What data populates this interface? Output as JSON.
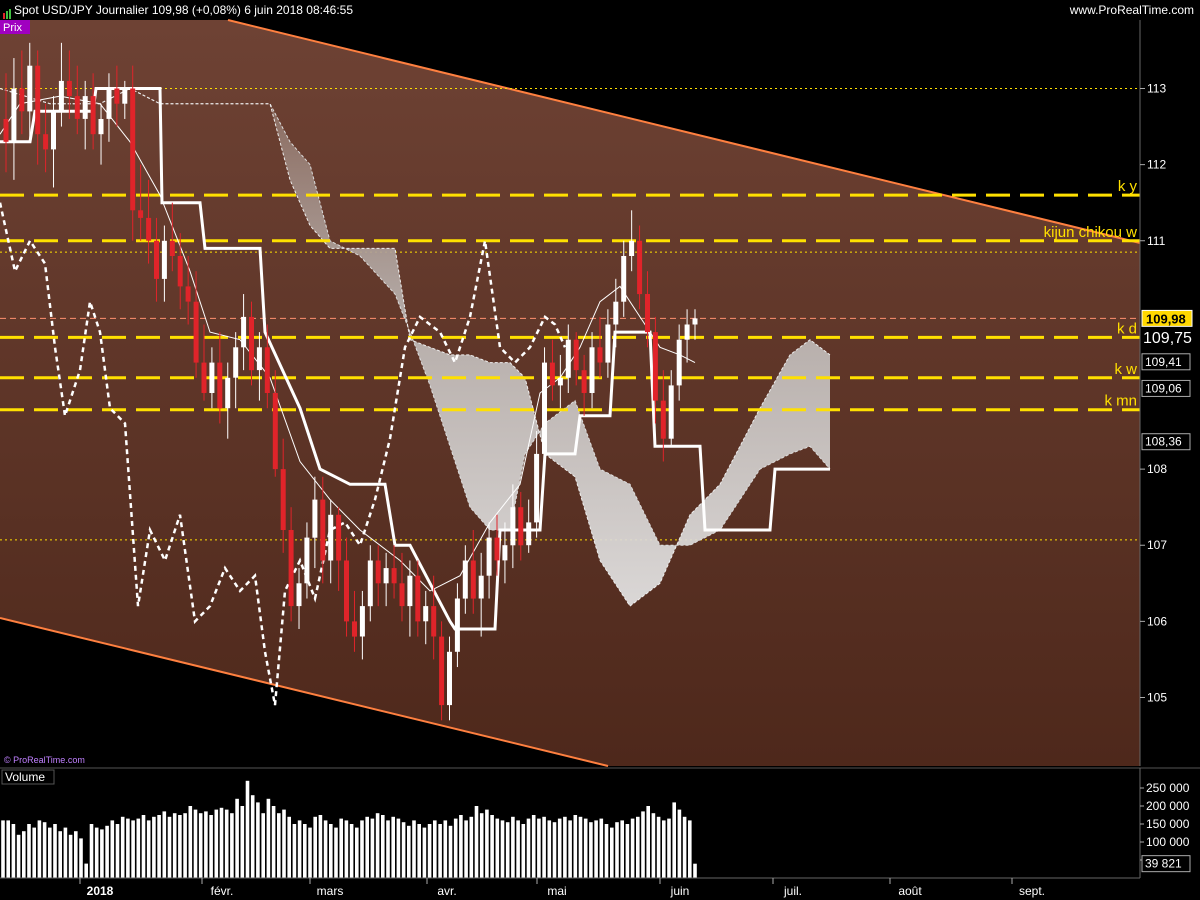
{
  "header": {
    "title": "Spot USD/JPY    Journalier    109,98 (+0,08%)    6 juin 2018 08:46:55",
    "site": "www.ProRealTime.com",
    "price_panel_label": "Prix",
    "volume_panel_label": "Volume",
    "watermark": "© ProRealTime.com"
  },
  "colors": {
    "background_price": "#5a3122",
    "up_candle": "#ffffff",
    "down_candle": "#e0242a",
    "channel": "#ff8040",
    "levels": "#ffe000",
    "cloud": "#bfbfbf"
  },
  "chart_data": [
    {
      "type": "line",
      "title": "",
      "ylim": [
        104.1,
        113.9
      ],
      "x_ticks": [
        "2018",
        "févr.",
        "mars",
        "avr.",
        "mai",
        "juin",
        "juil.",
        "août",
        "sept."
      ],
      "y_ticks": [
        "113",
        "112",
        "111",
        "108",
        "107",
        "106",
        "105"
      ],
      "price_tags": [
        {
          "label": "109,98",
          "value": 109.98,
          "style": "current"
        },
        {
          "label": "109,75",
          "value": 109.75,
          "style": "large"
        },
        {
          "label": "109,41",
          "value": 109.41,
          "style": "box"
        },
        {
          "label": "109,06",
          "value": 109.06,
          "style": "box"
        },
        {
          "label": "108,36",
          "value": 108.36,
          "style": "box"
        }
      ],
      "levels": [
        {
          "label": "k y",
          "value": 111.6
        },
        {
          "label": "kijun chikou w",
          "value": 111.0
        },
        {
          "label": "k d",
          "value": 109.73
        },
        {
          "label": "k w",
          "value": 109.2
        },
        {
          "label": "k mn",
          "value": 108.78
        }
      ],
      "dotted_levels": [
        113.0,
        110.85,
        107.07
      ],
      "series": [
        {
          "name": "Kijun",
          "x": [
            0,
            30,
            35,
            60,
            93,
            96,
            160,
            162,
            200,
            205,
            260,
            265,
            300,
            320,
            350,
            385,
            395,
            410,
            450,
            455,
            495,
            500,
            540,
            545,
            575,
            580,
            610,
            615,
            650,
            655,
            700,
            705,
            770,
            775,
            830
          ],
          "y": [
            112.3,
            112.3,
            112.7,
            112.7,
            112.7,
            113.0,
            113.0,
            111.5,
            111.5,
            110.9,
            110.9,
            109.8,
            108.8,
            108.0,
            107.8,
            107.8,
            107.0,
            107.0,
            106.0,
            105.9,
            105.9,
            107.2,
            107.2,
            108.2,
            108.2,
            108.7,
            108.7,
            109.8,
            109.8,
            108.3,
            108.3,
            107.2,
            107.2,
            108.0,
            108.0
          ]
        },
        {
          "name": "Tenkan",
          "x": [
            0,
            20,
            60,
            100,
            130,
            160,
            190,
            210,
            240,
            270,
            300,
            330,
            360,
            400,
            430,
            460,
            490,
            520,
            540,
            560,
            580,
            600,
            620,
            640,
            660,
            680,
            695
          ],
          "y": [
            112.4,
            112.8,
            112.9,
            112.8,
            112.3,
            111.6,
            110.6,
            109.8,
            109.7,
            109.2,
            108.1,
            107.6,
            107.2,
            106.8,
            106.4,
            106.6,
            107.3,
            107.8,
            109.0,
            109.2,
            109.6,
            110.2,
            110.4,
            110.0,
            109.6,
            109.5,
            109.4
          ]
        },
        {
          "name": "Chikou",
          "x": [
            0,
            15,
            30,
            45,
            55,
            65,
            80,
            90,
            100,
            110,
            125,
            138,
            150,
            165,
            180,
            195,
            210,
            225,
            240,
            255,
            265,
            275,
            285,
            300,
            315,
            330,
            345,
            360,
            375,
            390,
            405,
            420,
            440,
            455,
            470,
            485,
            500,
            515,
            530,
            545,
            555,
            565
          ],
          "y": [
            111.5,
            110.6,
            111.0,
            110.7,
            109.6,
            108.7,
            109.3,
            110.2,
            109.8,
            108.8,
            108.6,
            106.2,
            107.2,
            106.8,
            107.4,
            106.0,
            106.2,
            106.7,
            106.4,
            106.6,
            105.6,
            104.9,
            106.4,
            106.8,
            106.3,
            107.2,
            107.3,
            107.0,
            107.6,
            108.4,
            109.6,
            110.0,
            109.8,
            109.4,
            110.0,
            111.0,
            109.6,
            109.4,
            109.6,
            110.0,
            109.9,
            109.6
          ]
        }
      ],
      "cloud": {
        "x": [
          0,
          50,
          100,
          130,
          160,
          200,
          240,
          270,
          290,
          310,
          330,
          360,
          395,
          410,
          430,
          450,
          470,
          490,
          510,
          525,
          545,
          575,
          600,
          630,
          660,
          690,
          720,
          760,
          790,
          810,
          830
        ],
        "span_a": [
          113.0,
          112.8,
          112.8,
          113.0,
          112.8,
          112.8,
          112.8,
          112.8,
          112.3,
          112.0,
          111.0,
          110.8,
          110.3,
          109.8,
          109.1,
          108.3,
          107.5,
          107.2,
          107.2,
          108.2,
          108.6,
          108.9,
          108.0,
          107.8,
          107.0,
          107.0,
          107.2,
          108.0,
          108.2,
          108.3,
          108.0
        ],
        "span_b": [
          113.0,
          112.8,
          112.8,
          113.0,
          112.8,
          112.8,
          112.8,
          112.8,
          111.8,
          111.2,
          110.9,
          110.9,
          110.9,
          109.7,
          109.6,
          109.5,
          109.5,
          109.4,
          109.4,
          109.2,
          108.2,
          107.9,
          106.8,
          106.2,
          106.5,
          107.4,
          107.8,
          108.8,
          109.5,
          109.7,
          109.5
        ]
      },
      "candles": [
        {
          "o": 112.6,
          "h": 113.2,
          "l": 111.9,
          "c": 112.3
        },
        {
          "o": 112.3,
          "h": 113.4,
          "l": 111.8,
          "c": 113.0
        },
        {
          "o": 113.0,
          "h": 113.5,
          "l": 112.4,
          "c": 112.7
        },
        {
          "o": 112.7,
          "h": 113.6,
          "l": 112.3,
          "c": 113.3
        },
        {
          "o": 113.3,
          "h": 113.5,
          "l": 112.0,
          "c": 112.4
        },
        {
          "o": 112.4,
          "h": 112.8,
          "l": 111.9,
          "c": 112.2
        },
        {
          "o": 112.2,
          "h": 112.9,
          "l": 111.7,
          "c": 112.7
        },
        {
          "o": 112.7,
          "h": 113.6,
          "l": 112.5,
          "c": 113.1
        },
        {
          "o": 113.1,
          "h": 113.5,
          "l": 112.6,
          "c": 112.9
        },
        {
          "o": 112.9,
          "h": 113.3,
          "l": 112.4,
          "c": 112.6
        },
        {
          "o": 112.6,
          "h": 113.1,
          "l": 112.2,
          "c": 112.9
        },
        {
          "o": 112.9,
          "h": 113.2,
          "l": 112.2,
          "c": 112.4
        },
        {
          "o": 112.4,
          "h": 112.8,
          "l": 112.0,
          "c": 112.6
        },
        {
          "o": 112.6,
          "h": 113.2,
          "l": 112.3,
          "c": 113.0
        },
        {
          "o": 113.0,
          "h": 113.3,
          "l": 112.5,
          "c": 112.8
        },
        {
          "o": 112.8,
          "h": 113.1,
          "l": 112.6,
          "c": 113.0
        },
        {
          "o": 113.0,
          "h": 113.3,
          "l": 111.0,
          "c": 111.4
        },
        {
          "o": 111.4,
          "h": 112.0,
          "l": 111.0,
          "c": 111.3
        },
        {
          "o": 111.3,
          "h": 111.8,
          "l": 110.7,
          "c": 111.0
        },
        {
          "o": 111.0,
          "h": 111.3,
          "l": 110.2,
          "c": 110.5
        },
        {
          "o": 110.5,
          "h": 111.2,
          "l": 110.2,
          "c": 111.0
        },
        {
          "o": 111.0,
          "h": 111.5,
          "l": 110.6,
          "c": 110.8
        },
        {
          "o": 110.8,
          "h": 111.1,
          "l": 110.1,
          "c": 110.4
        },
        {
          "o": 110.4,
          "h": 110.8,
          "l": 109.9,
          "c": 110.2
        },
        {
          "o": 110.2,
          "h": 110.6,
          "l": 109.2,
          "c": 109.4
        },
        {
          "o": 109.4,
          "h": 109.9,
          "l": 108.9,
          "c": 109.0
        },
        {
          "o": 109.0,
          "h": 109.6,
          "l": 108.8,
          "c": 109.4
        },
        {
          "o": 109.4,
          "h": 109.8,
          "l": 108.6,
          "c": 108.8
        },
        {
          "o": 108.8,
          "h": 109.4,
          "l": 108.4,
          "c": 109.2
        },
        {
          "o": 109.2,
          "h": 109.8,
          "l": 108.8,
          "c": 109.6
        },
        {
          "o": 109.6,
          "h": 110.3,
          "l": 109.3,
          "c": 110.0
        },
        {
          "o": 110.0,
          "h": 110.2,
          "l": 109.1,
          "c": 109.3
        },
        {
          "o": 109.3,
          "h": 109.8,
          "l": 108.9,
          "c": 109.6
        },
        {
          "o": 109.6,
          "h": 109.9,
          "l": 108.8,
          "c": 109.0
        },
        {
          "o": 109.0,
          "h": 109.3,
          "l": 107.9,
          "c": 108.0
        },
        {
          "o": 108.0,
          "h": 108.4,
          "l": 106.9,
          "c": 107.2
        },
        {
          "o": 107.2,
          "h": 107.5,
          "l": 106.0,
          "c": 106.2
        },
        {
          "o": 106.2,
          "h": 106.7,
          "l": 105.9,
          "c": 106.5
        },
        {
          "o": 106.5,
          "h": 107.3,
          "l": 106.3,
          "c": 107.1
        },
        {
          "o": 107.1,
          "h": 107.9,
          "l": 106.7,
          "c": 107.6
        },
        {
          "o": 107.6,
          "h": 107.9,
          "l": 106.5,
          "c": 106.8
        },
        {
          "o": 106.8,
          "h": 107.6,
          "l": 106.5,
          "c": 107.4
        },
        {
          "o": 107.4,
          "h": 107.5,
          "l": 106.4,
          "c": 106.8
        },
        {
          "o": 106.8,
          "h": 107.1,
          "l": 105.8,
          "c": 106.0
        },
        {
          "o": 106.0,
          "h": 106.4,
          "l": 105.6,
          "c": 105.8
        },
        {
          "o": 105.8,
          "h": 106.4,
          "l": 105.5,
          "c": 106.2
        },
        {
          "o": 106.2,
          "h": 107.0,
          "l": 106.0,
          "c": 106.8
        },
        {
          "o": 106.8,
          "h": 107.0,
          "l": 106.2,
          "c": 106.5
        },
        {
          "o": 106.5,
          "h": 106.9,
          "l": 106.2,
          "c": 106.7
        },
        {
          "o": 106.7,
          "h": 107.0,
          "l": 106.3,
          "c": 106.5
        },
        {
          "o": 106.5,
          "h": 106.9,
          "l": 106.0,
          "c": 106.2
        },
        {
          "o": 106.2,
          "h": 106.8,
          "l": 105.8,
          "c": 106.6
        },
        {
          "o": 106.6,
          "h": 106.8,
          "l": 105.8,
          "c": 106.0
        },
        {
          "o": 106.0,
          "h": 106.4,
          "l": 105.7,
          "c": 106.2
        },
        {
          "o": 106.2,
          "h": 106.6,
          "l": 105.5,
          "c": 105.8
        },
        {
          "o": 105.8,
          "h": 106.0,
          "l": 104.7,
          "c": 104.9
        },
        {
          "o": 104.9,
          "h": 105.8,
          "l": 104.7,
          "c": 105.6
        },
        {
          "o": 105.6,
          "h": 106.5,
          "l": 105.4,
          "c": 106.3
        },
        {
          "o": 106.3,
          "h": 107.0,
          "l": 106.1,
          "c": 106.8
        },
        {
          "o": 106.8,
          "h": 107.2,
          "l": 106.1,
          "c": 106.3
        },
        {
          "o": 106.3,
          "h": 106.9,
          "l": 105.8,
          "c": 106.6
        },
        {
          "o": 106.6,
          "h": 107.3,
          "l": 106.3,
          "c": 107.1
        },
        {
          "o": 107.1,
          "h": 107.4,
          "l": 106.6,
          "c": 106.8
        },
        {
          "o": 106.8,
          "h": 107.3,
          "l": 106.5,
          "c": 107.0
        },
        {
          "o": 107.0,
          "h": 107.8,
          "l": 106.7,
          "c": 107.5
        },
        {
          "o": 107.5,
          "h": 107.7,
          "l": 106.8,
          "c": 107.0
        },
        {
          "o": 107.0,
          "h": 107.6,
          "l": 106.9,
          "c": 107.3
        },
        {
          "o": 107.3,
          "h": 108.5,
          "l": 107.1,
          "c": 108.2
        },
        {
          "o": 108.2,
          "h": 109.6,
          "l": 108.0,
          "c": 109.4
        },
        {
          "o": 109.4,
          "h": 109.7,
          "l": 108.9,
          "c": 109.1
        },
        {
          "o": 109.1,
          "h": 109.5,
          "l": 108.8,
          "c": 109.2
        },
        {
          "o": 109.2,
          "h": 109.9,
          "l": 109.0,
          "c": 109.7
        },
        {
          "o": 109.7,
          "h": 109.8,
          "l": 109.1,
          "c": 109.3
        },
        {
          "o": 109.3,
          "h": 109.5,
          "l": 108.7,
          "c": 109.0
        },
        {
          "o": 109.0,
          "h": 109.8,
          "l": 108.8,
          "c": 109.6
        },
        {
          "o": 109.6,
          "h": 110.0,
          "l": 109.2,
          "c": 109.4
        },
        {
          "o": 109.4,
          "h": 110.1,
          "l": 109.2,
          "c": 109.9
        },
        {
          "o": 109.9,
          "h": 110.5,
          "l": 109.6,
          "c": 110.2
        },
        {
          "o": 110.2,
          "h": 111.0,
          "l": 110.0,
          "c": 110.8
        },
        {
          "o": 110.8,
          "h": 111.4,
          "l": 110.6,
          "c": 111.0
        },
        {
          "o": 111.0,
          "h": 111.2,
          "l": 110.1,
          "c": 110.3
        },
        {
          "o": 110.3,
          "h": 110.6,
          "l": 109.6,
          "c": 109.8
        },
        {
          "o": 109.8,
          "h": 110.0,
          "l": 108.6,
          "c": 108.9
        },
        {
          "o": 108.9,
          "h": 109.3,
          "l": 108.1,
          "c": 108.4
        },
        {
          "o": 108.4,
          "h": 109.3,
          "l": 108.3,
          "c": 109.1
        },
        {
          "o": 109.1,
          "h": 109.9,
          "l": 108.9,
          "c": 109.7
        },
        {
          "o": 109.7,
          "h": 110.1,
          "l": 109.4,
          "c": 109.9
        },
        {
          "o": 109.9,
          "h": 110.1,
          "l": 109.7,
          "c": 109.98
        }
      ]
    },
    {
      "type": "bar",
      "title": "",
      "ylim": [
        0,
        300000
      ],
      "y_ticks": [
        "250 000",
        "200 000",
        "150 000",
        "100 000",
        "50 000"
      ],
      "last_value_label": "39 821",
      "values": [
        160000,
        160000,
        150000,
        120000,
        130000,
        150000,
        140000,
        160000,
        155000,
        140000,
        150000,
        130000,
        140000,
        120000,
        130000,
        110000,
        40000,
        150000,
        140000,
        135000,
        145000,
        160000,
        150000,
        170000,
        165000,
        160000,
        165000,
        175000,
        160000,
        170000,
        175000,
        185000,
        170000,
        180000,
        175000,
        180000,
        200000,
        190000,
        180000,
        185000,
        175000,
        190000,
        195000,
        190000,
        180000,
        220000,
        200000,
        270000,
        230000,
        210000,
        180000,
        220000,
        200000,
        180000,
        190000,
        170000,
        150000,
        160000,
        150000,
        140000,
        170000,
        175000,
        160000,
        150000,
        140000,
        165000,
        160000,
        150000,
        140000,
        160000,
        170000,
        165000,
        180000,
        175000,
        160000,
        170000,
        165000,
        155000,
        145000,
        160000,
        150000,
        140000,
        150000,
        160000,
        150000,
        160000,
        145000,
        165000,
        175000,
        160000,
        170000,
        200000,
        180000,
        190000,
        175000,
        165000,
        160000,
        155000,
        170000,
        160000,
        150000,
        165000,
        175000,
        165000,
        170000,
        160000,
        155000,
        165000,
        170000,
        160000,
        175000,
        170000,
        165000,
        155000,
        160000,
        165000,
        150000,
        140000,
        155000,
        160000,
        150000,
        165000,
        170000,
        185000,
        200000,
        180000,
        170000,
        160000,
        165000,
        210000,
        190000,
        170000,
        160000,
        39821
      ]
    }
  ]
}
